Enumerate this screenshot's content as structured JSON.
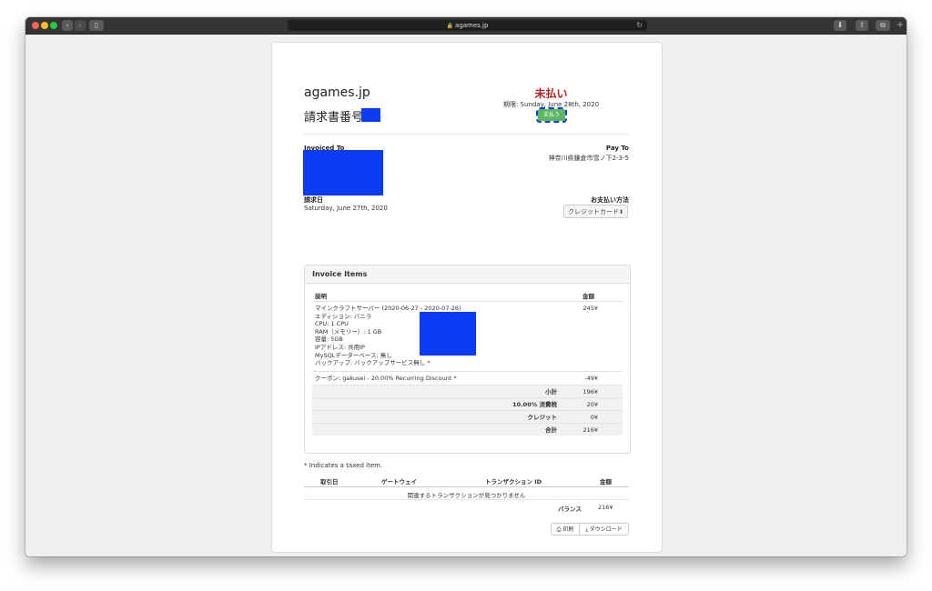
{
  "browser": {
    "url": "agames.jp",
    "back_icon": "chevron-left-icon",
    "forward_icon": "chevron-right-icon"
  },
  "invoice": {
    "company": "agames.jp",
    "number_label": "請求書番号",
    "status": "未払い",
    "due": "期限: Sunday, June 28th, 2020",
    "pay_button": "支払う",
    "invoiced_to_label": "Invoiced To",
    "pay_to_label": "Pay To",
    "pay_to_address": "神奈川県鎌倉市雪ノ下2-3-5",
    "date_label": "請求日",
    "date_value": "Saturday, June 27th, 2020",
    "payment_method_label": "お支払い方法",
    "payment_method_value": "クレジットカード"
  },
  "items_panel": {
    "title": "Invoice Items",
    "col_description": "説明",
    "col_amount": "金額",
    "item_lines": [
      "マインクラフトサーバー (2020-06-27 - 2020-07-26)",
      "エディション: バニラ",
      "CPU: 1 CPU",
      "RAM（メモリー）: 1 GB",
      "容量: 5GB",
      "IPアドレス: 共用IP",
      "MySQLデーターベース: 無し",
      "バックアップ: バックアップサービス無し *"
    ],
    "item_amount": "245¥",
    "coupon": "クーポン: gakusei - 20.00% Recurring Discount *",
    "coupon_amount": "-49¥",
    "subtotal_label": "小計",
    "subtotal": "196¥",
    "tax_label": "10.00% 消費税",
    "tax": "20¥",
    "credit_label": "クレジット",
    "credit": "0¥",
    "total_label": "合計",
    "total": "216¥"
  },
  "taxed_note": "* Indicates a taxed item.",
  "transactions": {
    "col_date": "取引日",
    "col_gateway": "ゲートウェイ",
    "col_id": "トランザクション ID",
    "col_amount": "金額",
    "empty": "関連するトランザクションが見つかりません",
    "balance_label": "バランス",
    "balance": "216¥"
  },
  "actions": {
    "print": "印刷",
    "download": "ダウンロード"
  }
}
